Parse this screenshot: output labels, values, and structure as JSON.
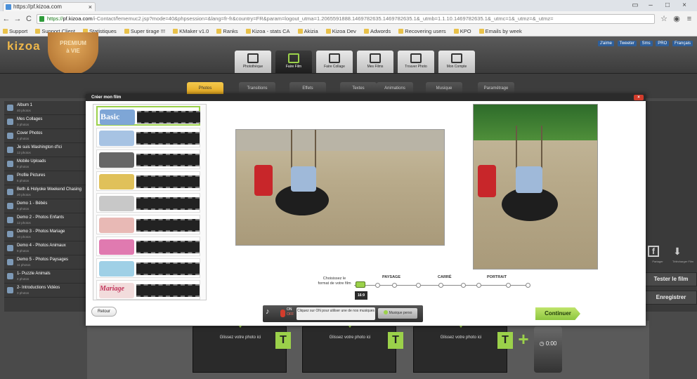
{
  "browser": {
    "tab_title": "https://pf.kizoa.com",
    "tab_close": "×",
    "window_controls": [
      "▭",
      "–",
      "□",
      "×"
    ],
    "back": "←",
    "forward": "→",
    "reload": "C",
    "url_scheme": "https://",
    "url_host": "pf.kizoa.com",
    "url_rest": "/i-Contact/fememuc2.jsp?mode=40&phpsession=&lang=fr-fr&country=FR&param=logout_utma=1.2065591888.1469782635.1469782635.1&_utmb=1.1.10.1469782635.1&_utmc=1&_utmz=&_utmz=",
    "bookmarks": [
      "Support",
      "Support Client",
      "Statistiques",
      "Super tirage !!!",
      "KMaker v1.0",
      "Ranks",
      "Kizoa - stats CA",
      "Akizia",
      "Kizoa Dev",
      "Adwords",
      "Recovering users",
      "KPO",
      "Emails by week"
    ]
  },
  "app": {
    "logo_pre": "kiz",
    "logo_accent": "o",
    "logo_post": "a",
    "premium_line1": "PREMIUM",
    "premium_line2": "à VIE",
    "topright": [
      "J'aime",
      "Tweeter",
      "Sms",
      "PRO",
      "Français"
    ],
    "modes": [
      {
        "label": "Photothèque",
        "active": false
      },
      {
        "label": "Faire Film",
        "active": true
      },
      {
        "label": "Faire Collage",
        "active": false
      },
      {
        "label": "Mes Films",
        "active": false
      },
      {
        "label": "Trouver Photo",
        "active": false
      },
      {
        "label": "Mon Compte",
        "active": false
      }
    ],
    "subtabs": [
      {
        "label": "Photos",
        "active": true
      },
      {
        "label": "Transitions",
        "active": false
      },
      {
        "label": "Effets",
        "active": false
      },
      {
        "label": "Textes",
        "active": false
      },
      {
        "label": "Animations",
        "active": false
      },
      {
        "label": "Musique",
        "active": false
      },
      {
        "label": "Paramétrage",
        "active": false
      }
    ]
  },
  "sidebar": {
    "items": [
      {
        "title": "Album 1",
        "sub": "40 photos"
      },
      {
        "title": "Mes Collages",
        "sub": "3 photos"
      },
      {
        "title": "Cover Photos",
        "sub": "4 photos"
      },
      {
        "title": "Je suis Washington d'Ici",
        "sub": "12 photos"
      },
      {
        "title": "Mobile Uploads",
        "sub": "8 photos"
      },
      {
        "title": "Profile Pictures",
        "sub": "6 photos"
      },
      {
        "title": "Beth & Holyoke Weekend Chasing",
        "sub": "20 photos"
      },
      {
        "title": "Demo 1 - Bébés",
        "sub": "8 photos"
      },
      {
        "title": "Demo 2 - Photos Enfants",
        "sub": "12 photos"
      },
      {
        "title": "Demo 3 - Photos Mariage",
        "sub": "10 photos"
      },
      {
        "title": "Demo 4 - Photos Animaux",
        "sub": "9 photos"
      },
      {
        "title": "Demo 5 - Photos Paysages",
        "sub": "11 photos"
      },
      {
        "title": "1- Puzzle Animals",
        "sub": "4 photos"
      },
      {
        "title": "2- Introductions Vidéos",
        "sub": "3 photos"
      }
    ]
  },
  "right_panel": {
    "tester": "Tester le film",
    "enregistrer": "Enregistrer",
    "icon_labels": [
      "Partager",
      "Télécharger Film"
    ]
  },
  "modal": {
    "title": "Créer mon film",
    "close": "×",
    "themes": [
      {
        "name": "Basic",
        "color": "#7ea6d6"
      },
      {
        "name": "",
        "color": "#a7c3e3"
      },
      {
        "name": "",
        "color": "#666666"
      },
      {
        "name": "",
        "color": "#e0c15a"
      },
      {
        "name": "",
        "color": "#c8c8c8"
      },
      {
        "name": "",
        "color": "#e8b9b5"
      },
      {
        "name": "",
        "color": "#e07ab0"
      },
      {
        "name": "",
        "color": "#9fd0e6"
      },
      {
        "name": "Mariage",
        "color": "#f2dcdc"
      }
    ],
    "format_label": "Choisissez le format de votre film",
    "formats": [
      "PAYSAGE",
      "CARRÉ",
      "PORTRAIT"
    ],
    "ratio": "16:9",
    "retour": "Retour",
    "music_on": "ON",
    "music_off": "OFF",
    "music_msg": "Cliquez sur ON pour utiliser une de nos musiques",
    "music_btn": "Musique perso",
    "continuer": "Continuer"
  },
  "filmstrip": {
    "slot_label": "Glissez votre photo ici",
    "text_button": "T",
    "add": "+",
    "timer": "0:00"
  }
}
